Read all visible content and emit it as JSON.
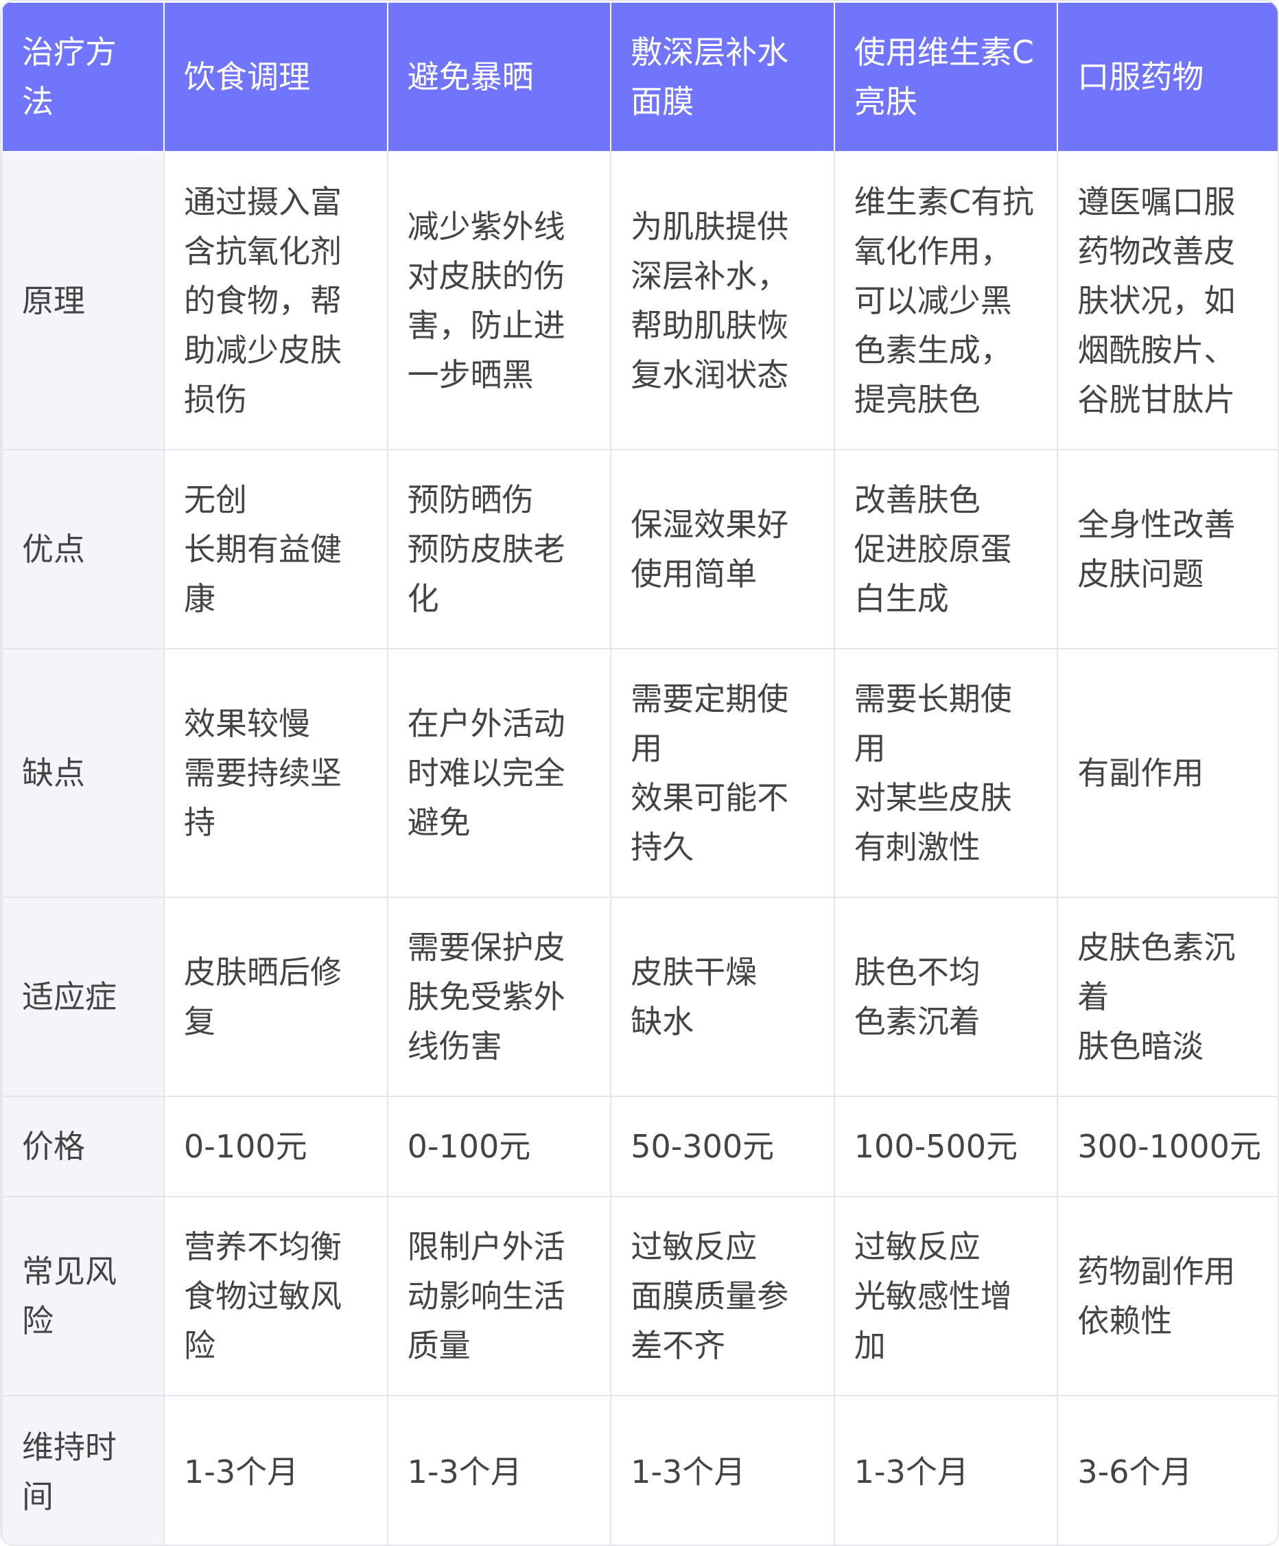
{
  "header": [
    "治疗方法",
    "饮食调理",
    "避免暴晒",
    "敷深层补水面膜",
    "使用维生素C亮肤",
    "口服药物"
  ],
  "rows": [
    {
      "label": "原理",
      "cells": [
        "通过摄入富含抗氧化剂的食物，帮助减少皮肤损伤",
        "减少紫外线对皮肤的伤害，防止进一步晒黑",
        "为肌肤提供深层补水，帮助肌肤恢复水润状态",
        "维生素C有抗氧化作用，可以减少黑色素生成，提亮肤色",
        "遵医嘱口服药物改善皮肤状况，如烟酰胺片、谷胱甘肽片"
      ]
    },
    {
      "label": "优点",
      "cells": [
        "无创\n长期有益健康",
        "预防晒伤\n预防皮肤老化",
        "保湿效果好\n使用简单",
        "改善肤色\n促进胶原蛋白生成",
        "全身性改善皮肤问题"
      ]
    },
    {
      "label": "缺点",
      "cells": [
        "效果较慢\n需要持续坚持",
        "在户外活动时难以完全避免",
        "需要定期使用\n效果可能不持久",
        "需要长期使用\n对某些皮肤有刺激性",
        "有副作用"
      ]
    },
    {
      "label": "适应症",
      "cells": [
        "皮肤晒后修复",
        "需要保护皮肤免受紫外线伤害",
        "皮肤干燥\n缺水",
        "肤色不均\n色素沉着",
        "皮肤色素沉着\n肤色暗淡"
      ]
    },
    {
      "label": "价格",
      "cells": [
        "0-100元",
        "0-100元",
        "50-300元",
        "100-500元",
        "300-1000元"
      ]
    },
    {
      "label": "常见风险",
      "cells": [
        "营养不均衡\n食物过敏风险",
        "限制户外活动影响生活质量",
        "过敏反应\n面膜质量参差不齐",
        "过敏反应\n光敏感性增加",
        "药物副作用\n依赖性"
      ]
    },
    {
      "label": "维持时间",
      "cells": [
        "1-3个月",
        "1-3个月",
        "1-3个月",
        "1-3个月",
        "3-6个月"
      ]
    }
  ],
  "colors": {
    "header_bg": "#7075fb",
    "header_text": "#ffffff",
    "label_bg": "#f4f5fb",
    "border": "#e4e4ec",
    "text": "#444444"
  }
}
